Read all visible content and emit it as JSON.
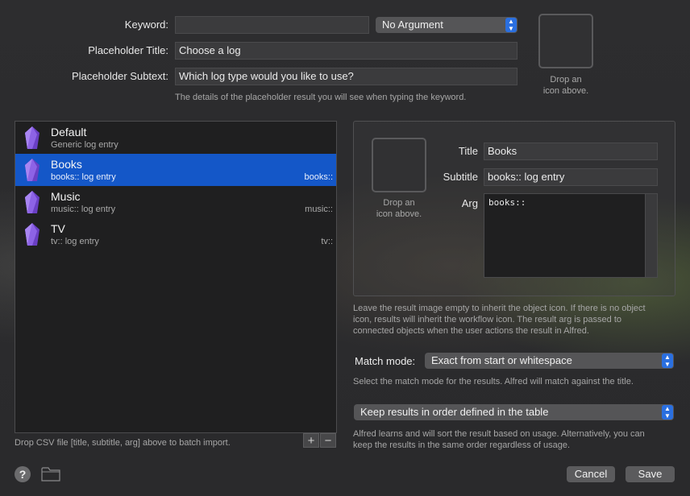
{
  "form": {
    "keyword_label": "Keyword:",
    "keyword_value": "",
    "argument_mode": "No Argument",
    "placeholder_title_label": "Placeholder Title:",
    "placeholder_title_value": "Choose a log",
    "placeholder_subtext_label": "Placeholder Subtext:",
    "placeholder_subtext_value": "Which log type would you like to use?",
    "placeholder_hint": "The details of the placeholder result you will see when typing the keyword.",
    "icon_drop_line1": "Drop an",
    "icon_drop_line2": "icon above."
  },
  "list": {
    "items": [
      {
        "title": "Default",
        "subtitle": "Generic log entry",
        "arg": "",
        "icon": "obsidian-gem-icon",
        "selected": false
      },
      {
        "title": "Books",
        "subtitle": "books:: log entry",
        "arg": "books::",
        "icon": "obsidian-gem-icon",
        "selected": true
      },
      {
        "title": "Music",
        "subtitle": "music:: log entry",
        "arg": "music::",
        "icon": "obsidian-gem-icon",
        "selected": false
      },
      {
        "title": "TV",
        "subtitle": "tv:: log entry",
        "arg": "tv::",
        "icon": "obsidian-gem-icon",
        "selected": false
      }
    ],
    "add_label": "+",
    "remove_label": "−",
    "csv_hint": "Drop CSV file [title, subtitle, arg] above to batch import."
  },
  "detail": {
    "icon_drop_line1": "Drop an",
    "icon_drop_line2": "icon above.",
    "title_label": "Title",
    "title_value": "Books",
    "subtitle_label": "Subtitle",
    "subtitle_value": "books:: log entry",
    "arg_label": "Arg",
    "arg_value": "books::",
    "result_hint_1": "Leave the result image empty to inherit the object icon. If there is no object",
    "result_hint_2": "icon, results will inherit the workflow icon. The result arg is passed to",
    "result_hint_3": "connected objects when the user actions the result in Alfred."
  },
  "match": {
    "label": "Match mode:",
    "value": "Exact from start or whitespace",
    "hint": "Select the match mode for the results. Alfred will match against the title."
  },
  "order": {
    "value": "Keep results in order defined in the table",
    "hint_1": "Alfred learns and will sort the result based on usage. Alternatively, you can",
    "hint_2": "keep the results in the same order regardless of usage."
  },
  "footer": {
    "help_label": "?",
    "cancel_label": "Cancel",
    "save_label": "Save"
  },
  "colors": {
    "selection": "#1457c8",
    "accent_stepper": "#2a6fe0",
    "gem_purple": "#7b4fd6"
  }
}
